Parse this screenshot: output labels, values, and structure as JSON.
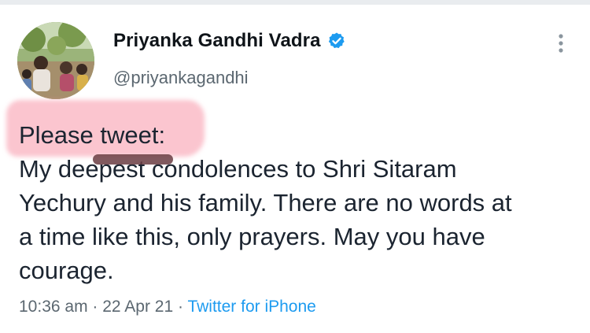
{
  "author": {
    "display_name": "Priyanka Gandhi Vadra",
    "handle": "@priyankagandhi",
    "verified": true
  },
  "icons": {
    "verified": "verified-badge-icon",
    "more": "more-options-icon"
  },
  "colors": {
    "verified_badge": "#1d9bf0",
    "source_link": "#1d9bf0",
    "highlight": "#f796a8",
    "meta_text": "#5b6770"
  },
  "tweet": {
    "lines": [
      "Please tweet:",
      "My deepest condolences to Shri Sitaram",
      "Yechury and his family. There are no words at",
      "a time like this, only prayers. May you have",
      "courage."
    ]
  },
  "meta": {
    "time": "10:36 am",
    "separator_1": " · ",
    "date": "22 Apr 21",
    "separator_2": " · ",
    "source": "Twitter for iPhone"
  }
}
